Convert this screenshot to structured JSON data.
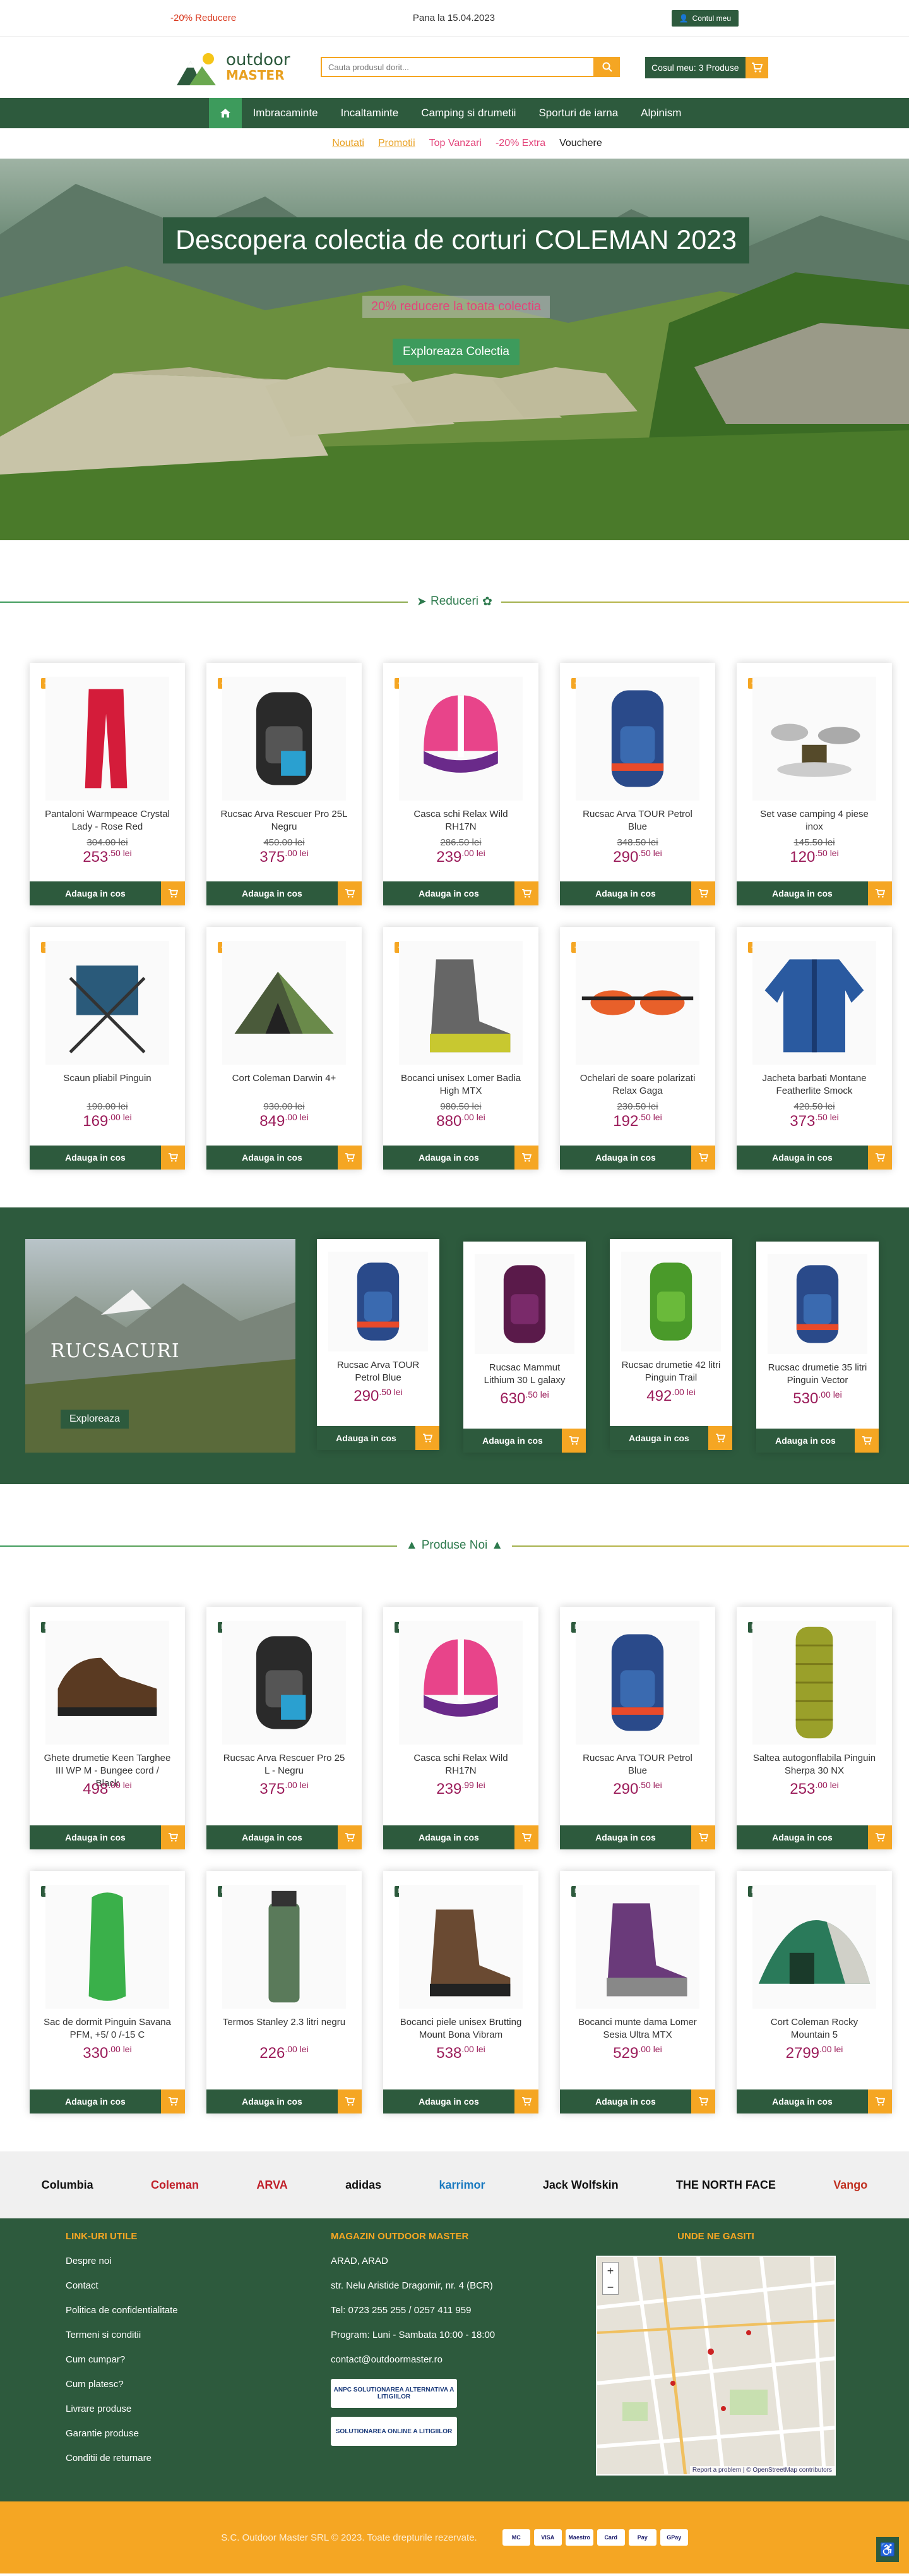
{
  "topbar": {
    "promo": "-20% Reducere",
    "date": "Pana la 15.04.2023",
    "account": "Contul meu"
  },
  "header": {
    "logo_line1": "outdoor",
    "logo_line2": "MASTER",
    "search_placeholder": "Cauta produsul dorit...",
    "cart": "Cosul meu: 3 Produse"
  },
  "nav": [
    "Imbracaminte",
    "Incaltaminte",
    "Camping si drumetii",
    "Sporturi de iarna",
    "Alpinism"
  ],
  "subnav": [
    "Noutati",
    "Promotii",
    "Top Vanzari",
    "-20% Extra",
    "Vouchere"
  ],
  "hero": {
    "title": "Descopera colectia de corturi COLEMAN 2023",
    "subtitle": "20% reducere la toata colectia",
    "button": "Exploreaza Colectia"
  },
  "section1": "Reduceri",
  "section2": "Produse Noi",
  "add_label": "Adauga in cos",
  "discounts": [
    {
      "name": "Pantaloni Warmpeace Crystal Lady - Rose Red",
      "old": "304.00 lei",
      "price": "253",
      "dec": ".50 lei",
      "badge": "-20%",
      "kind": "pants"
    },
    {
      "name": "Rucsac Arva Rescuer Pro 25L Negru",
      "old": "450.00 lei",
      "price": "375",
      "dec": ".00 lei",
      "badge": "-20%",
      "kind": "packblack"
    },
    {
      "name": "Casca schi Relax Wild RH17N",
      "old": "286.50 lei",
      "price": "239",
      "dec": ".00 lei",
      "badge": "-20%",
      "kind": "helmet"
    },
    {
      "name": "Rucsac Arva TOUR Petrol Blue",
      "old": "348.50 lei",
      "price": "290",
      "dec": ".50 lei",
      "badge": "-20%",
      "kind": "packblue"
    },
    {
      "name": "Set vase camping 4 piese inox",
      "old": "145.50 lei",
      "price": "120",
      "dec": ".50 lei",
      "badge": "-20%",
      "kind": "pots"
    },
    {
      "name": "Scaun pliabil Pinguin",
      "old": "190.00 lei",
      "price": "169",
      "dec": ".00 lei",
      "badge": "-20%",
      "kind": "chair"
    },
    {
      "name": "Cort Coleman Darwin 4+",
      "old": "930.00 lei",
      "price": "849",
      "dec": ".00 lei",
      "badge": "-20%",
      "kind": "tent"
    },
    {
      "name": "Bocanci unisex Lomer Badia High MTX",
      "old": "980.50 lei",
      "price": "880",
      "dec": ".00 lei",
      "badge": "-20%",
      "kind": "bootgrey"
    },
    {
      "name": "Ochelari de soare polarizati Relax Gaga",
      "old": "230.50 lei",
      "price": "192",
      "dec": ".50 lei",
      "badge": "-20%",
      "kind": "glasses"
    },
    {
      "name": "Jacheta barbati Montane Featherlite Smock",
      "old": "420.50 lei",
      "price": "373",
      "dec": ".50 lei",
      "badge": "-20%",
      "kind": "jacket"
    }
  ],
  "rucsacuri": {
    "title": "RUCSACURI",
    "button": "Exploreaza",
    "items": [
      {
        "name": "Rucsac Arva TOUR Petrol Blue",
        "price": "290",
        "dec": ".50 lei",
        "kind": "packblue"
      },
      {
        "name": "Rucsac Mammut Lithium 30 L galaxy",
        "price": "630",
        "dec": ".50 lei",
        "kind": "packpurple"
      },
      {
        "name": "Rucsac drumetie 42 litri Pinguin Trail",
        "price": "492",
        "dec": ".00 lei",
        "kind": "packgreen"
      },
      {
        "name": "Rucsac drumetie 35 litri Pinguin Vector",
        "price": "530",
        "dec": ".00 lei",
        "kind": "packblue"
      }
    ]
  },
  "newproducts": [
    {
      "name": "Ghete drumetie Keen Targhee III WP M - Bungee cord / Black",
      "price": "498",
      "dec": ".00 lei",
      "badge": "Nou",
      "kind": "shoe"
    },
    {
      "name": "Rucsac Arva Rescuer Pro 25 L - Negru",
      "price": "375",
      "dec": ".00 lei",
      "badge": "Nou",
      "kind": "packblack"
    },
    {
      "name": "Casca schi Relax Wild RH17N",
      "price": "239",
      "dec": ".99 lei",
      "badge": "Nou",
      "kind": "helmet"
    },
    {
      "name": "Rucsac Arva TOUR Petrol Blue",
      "price": "290",
      "dec": ".50 lei",
      "badge": "Nou",
      "kind": "packblue"
    },
    {
      "name": "Saltea autogonflabila Pinguin Sherpa 30 NX",
      "price": "253",
      "dec": ".00 lei",
      "badge": "Nou",
      "kind": "mat"
    },
    {
      "name": "Sac de dormit Pinguin Savana PFM, +5/ 0 /-15 C",
      "price": "330",
      "dec": ".00 lei",
      "badge": "Nou",
      "kind": "sleeping"
    },
    {
      "name": "Termos Stanley 2.3 litri negru",
      "price": "226",
      "dec": ".00 lei",
      "badge": "Nou",
      "kind": "thermos"
    },
    {
      "name": "Bocanci piele unisex Brutting Mount Bona Vibram",
      "price": "538",
      "dec": ".00 lei",
      "badge": "Nou",
      "kind": "bootbrown"
    },
    {
      "name": "Bocanci munte dama Lomer Sesia Ultra MTX",
      "price": "529",
      "dec": ".00 lei",
      "badge": "Nou",
      "kind": "bootpurple"
    },
    {
      "name": "Cort Coleman Rocky Mountain 5",
      "price": "2799",
      "dec": ".00 lei",
      "badge": "Nou",
      "kind": "bigtent"
    }
  ],
  "brands": [
    "Columbia",
    "Coleman",
    "ARVA",
    "adidas",
    "karrimor",
    "Jack Wolfskin",
    "THE NORTH FACE",
    "Vango"
  ],
  "footer": {
    "col1_title": "LINK-URI UTILE",
    "links": [
      "Despre noi",
      "Contact",
      "Politica de confidentialitate",
      "Termeni si conditii",
      "Cum cumpar?",
      "Cum platesc?",
      "Livrare produse",
      "Garantie produse",
      "Conditii de returnare"
    ],
    "col2_title": "MAGAZIN OUTDOOR MASTER",
    "info": [
      "ARAD, ARAD",
      "str. Nelu Aristide Dragomir, nr. 4 (BCR)",
      "Tel: 0723 255 255 / 0257 411 959",
      "Program: Luni - Sambata 10:00 - 18:00",
      "contact@outdoormaster.ro"
    ],
    "anpc1": "ANPC SOLUTIONAREA ALTERNATIVA A LITIGIILOR",
    "anpc2": "SOLUTIONAREA ONLINE A LITIGIILOR",
    "col3_title": "UNDE NE GASITI",
    "map_credit": "Report a problem | © OpenStreetMap contributors"
  },
  "bottom": {
    "copyright": "S.C. Outdoor Master SRL © 2023. Toate drepturile rezervate.",
    "pays": [
      "MC",
      "VISA",
      "Maestro",
      "Card",
      "Pay",
      "GPay"
    ]
  },
  "colors": {
    "green": "#2d5a3d",
    "orange": "#f5a623",
    "price": "#9b1c5a"
  }
}
